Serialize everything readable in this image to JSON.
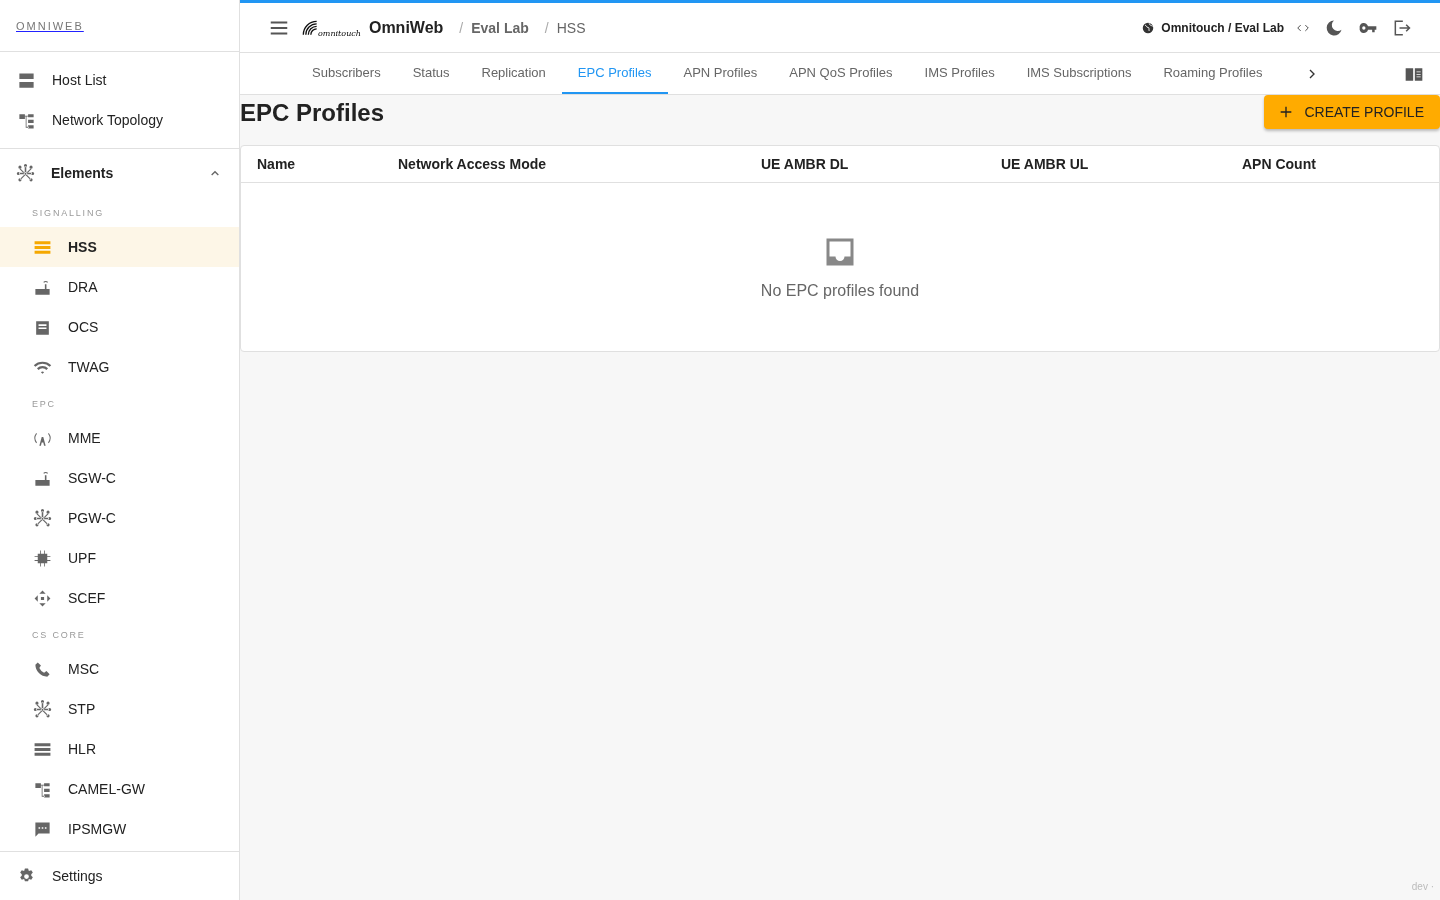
{
  "sidebar": {
    "brand": "OMNIWEB",
    "top_items": [
      {
        "label": "Host List",
        "selected": false
      },
      {
        "label": "Network Topology",
        "selected": false
      }
    ],
    "group": {
      "label": "Elements",
      "expanded": true,
      "sections": [
        {
          "label": "SIGNALLING",
          "items": [
            {
              "label": "HSS",
              "selected": true
            },
            {
              "label": "DRA",
              "selected": false
            },
            {
              "label": "OCS",
              "selected": false
            },
            {
              "label": "TWAG",
              "selected": false
            }
          ]
        },
        {
          "label": "EPC",
          "items": [
            {
              "label": "MME",
              "selected": false
            },
            {
              "label": "SGW-C",
              "selected": false
            },
            {
              "label": "PGW-C",
              "selected": false
            },
            {
              "label": "UPF",
              "selected": false
            },
            {
              "label": "SCEF",
              "selected": false
            }
          ]
        },
        {
          "label": "CS CORE",
          "items": [
            {
              "label": "MSC",
              "selected": false
            },
            {
              "label": "STP",
              "selected": false
            },
            {
              "label": "HLR",
              "selected": false
            },
            {
              "label": "CAMEL-GW",
              "selected": false
            },
            {
              "label": "IPSMGW",
              "selected": false
            }
          ]
        }
      ]
    },
    "settings": "Settings"
  },
  "header": {
    "logo_text": "omnitouch",
    "app_name": "OmniWeb",
    "breadcrumbs": [
      "Eval Lab",
      "HSS"
    ],
    "separator": "/",
    "tenant": "Omnitouch / Eval Lab"
  },
  "tabs": [
    {
      "label": "Subscribers",
      "selected": false
    },
    {
      "label": "Status",
      "selected": false
    },
    {
      "label": "Replication",
      "selected": false
    },
    {
      "label": "EPC Profiles",
      "selected": true
    },
    {
      "label": "APN Profiles",
      "selected": false
    },
    {
      "label": "APN QoS Profiles",
      "selected": false
    },
    {
      "label": "IMS Profiles",
      "selected": false
    },
    {
      "label": "IMS Subscriptions",
      "selected": false
    },
    {
      "label": "Roaming Profiles",
      "selected": false
    }
  ],
  "page": {
    "title": "EPC Profiles",
    "create_button": "CREATE PROFILE"
  },
  "table": {
    "columns": [
      "Name",
      "Network Access Mode",
      "UE AMBR DL",
      "UE AMBR UL",
      "APN Count"
    ],
    "empty_message": "No EPC profiles found"
  },
  "footer": "dev ·"
}
